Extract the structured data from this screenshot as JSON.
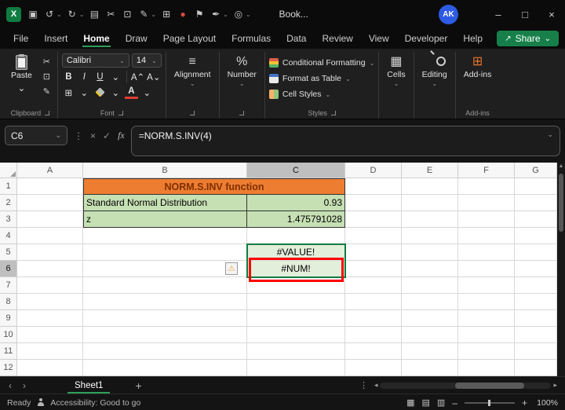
{
  "titlebar": {
    "title": "Book...",
    "avatar": "AK"
  },
  "qat": {
    "icons": [
      {
        "name": "save",
        "glyph": "▣"
      },
      {
        "name": "undo",
        "glyph": "↺"
      },
      {
        "name": "redo",
        "glyph": "↻"
      },
      {
        "name": "book",
        "glyph": "▤"
      },
      {
        "name": "cut",
        "glyph": "✂"
      },
      {
        "name": "copy",
        "glyph": "⊡"
      },
      {
        "name": "format-painter",
        "glyph": "✎"
      },
      {
        "name": "pivot-table",
        "glyph": "⊞"
      },
      {
        "name": "record",
        "glyph": "●"
      },
      {
        "name": "flag",
        "glyph": "⚑"
      },
      {
        "name": "pen",
        "glyph": "✒"
      },
      {
        "name": "copilot",
        "glyph": "◎"
      }
    ]
  },
  "icons": {
    "excel_logo": "X",
    "chevron": "⌄",
    "share_arrow": "↗",
    "minimize": "–",
    "maximize": "□",
    "close": "×",
    "cut": "✂",
    "copy": "⊡",
    "format_painter": "✎",
    "bold": "B",
    "italic": "I",
    "underline": "U",
    "grow_font": "A⌃",
    "shrink_font": "A⌄",
    "borders": "⊞",
    "font_color": "A",
    "align": "≡",
    "percent": "%",
    "cells": "▦",
    "addins": "⊞",
    "vdots": "⋮",
    "cancel": "×",
    "enter": "✓",
    "fx": "fx",
    "warning": "⚠",
    "scroll_up": "▲",
    "tab_prev": "‹",
    "tab_next": "›",
    "add_sheet": "+",
    "hscroll_left": "◂",
    "hscroll_right": "▸",
    "view_normal": "▦",
    "view_layout": "▤",
    "view_break": "▥",
    "zoom_out": "–",
    "zoom_in": "+"
  },
  "menubar": {
    "items": [
      "File",
      "Insert",
      "Home",
      "Draw",
      "Page Layout",
      "Formulas",
      "Data",
      "Review",
      "View",
      "Developer",
      "Help"
    ],
    "active": "Home",
    "share": "Share"
  },
  "ribbon": {
    "paste": "Paste",
    "font_name": "Calibri",
    "font_size": "14",
    "styles_items": [
      "Conditional Formatting",
      "Format as Table",
      "Cell Styles"
    ],
    "groups": {
      "clipboard": "Clipboard",
      "font": "Font",
      "alignment": "Alignment",
      "number": "Number",
      "styles": "Styles",
      "cells": "Cells",
      "editing": "Editing",
      "addins": "Add-ins"
    }
  },
  "formula_bar": {
    "name_box": "C6",
    "formula": "=NORM.S.INV(4)"
  },
  "grid": {
    "columns": [
      "A",
      "B",
      "C",
      "D",
      "E",
      "F",
      "G"
    ],
    "rows": [
      "1",
      "2",
      "3",
      "4",
      "5",
      "6",
      "7",
      "8",
      "9",
      "10",
      "11",
      "12"
    ],
    "selected_cell": "C6",
    "cells": {
      "title": "NORM.S.INV function",
      "b2": "Standard Normal Distribution",
      "c2": "0.93",
      "b3": "z",
      "c3": "1.475791028",
      "c5": "#VALUE!",
      "c6": "#NUM!"
    },
    "colors": {
      "title_fill": "#ED7D31",
      "title_text": "#7E2F00",
      "data_fill": "#C6E0B4",
      "result_fill": "#E2EFDA",
      "annotation": "#FE0000",
      "selection": "#107C41"
    }
  },
  "sheet_tabs": {
    "active": "Sheet1"
  },
  "status_bar": {
    "ready": "Ready",
    "accessibility": "Accessibility: Good to go",
    "zoom": "100%"
  }
}
